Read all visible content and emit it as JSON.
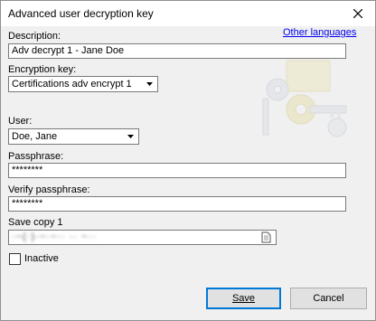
{
  "window": {
    "title": "Advanced user decryption key",
    "close_icon": "close-icon"
  },
  "form": {
    "description_label": "Description:",
    "description_value": "Adv decrypt 1 - Jane Doe",
    "other_languages_link": "Other languages",
    "encryption_key_label": "Encryption key:",
    "encryption_key_value": "Certifications adv encrypt 1",
    "user_label": "User:",
    "user_value": "Doe, Jane",
    "passphrase_label": "Passphrase:",
    "passphrase_value": "********",
    "verify_label": "Verify passphrase:",
    "verify_value": "********",
    "save_copy_label": "Save copy 1",
    "save_copy_value": "·~(·)·~·~·· ·· ~··",
    "inactive_label": "Inactive",
    "inactive_checked": false
  },
  "buttons": {
    "save": "Save",
    "cancel": "Cancel"
  },
  "icons": {
    "close": "close-icon",
    "dropdown": "chevron-down-icon",
    "browse": "document-icon",
    "keys": "keys-icon"
  },
  "colors": {
    "accent": "#0078d7",
    "link": "#0000ee",
    "background": "#f0f0f0"
  }
}
